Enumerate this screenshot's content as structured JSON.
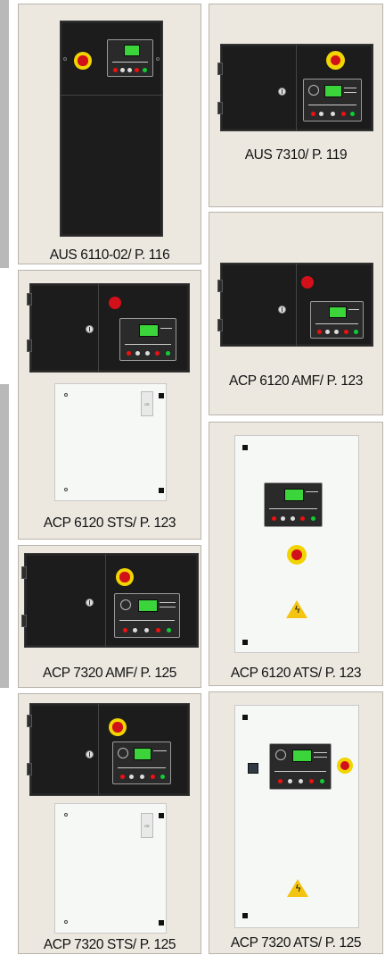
{
  "products": [
    {
      "caption": "AUS 6110-02/ P. 116"
    },
    {
      "caption": "AUS 7310/ P. 119"
    },
    {
      "caption": "ACP 6120 AMF/ P. 123"
    },
    {
      "caption": "ACP 6120 STS/ P. 123"
    },
    {
      "caption": "ACP 6120 ATS/ P. 123"
    },
    {
      "caption": "ACP 7320 AMF/ P. 125"
    },
    {
      "caption": "ACP 7320 STS/ P. 125"
    },
    {
      "caption": "ACP 7320 ATS/ P. 125"
    }
  ],
  "icons": {
    "emergency_stop": "emergency-stop-icon",
    "door_lock": "door-lock-icon",
    "controller": "controller-icon",
    "warning": "warning-icon"
  },
  "colors": {
    "card_background": "#ece8e0",
    "cabinet": "#1c1c1c",
    "estop_ring": "#f1d400",
    "estop_button": "#d2101a",
    "screen": "#3bd43b",
    "warning": "#f3c512"
  }
}
